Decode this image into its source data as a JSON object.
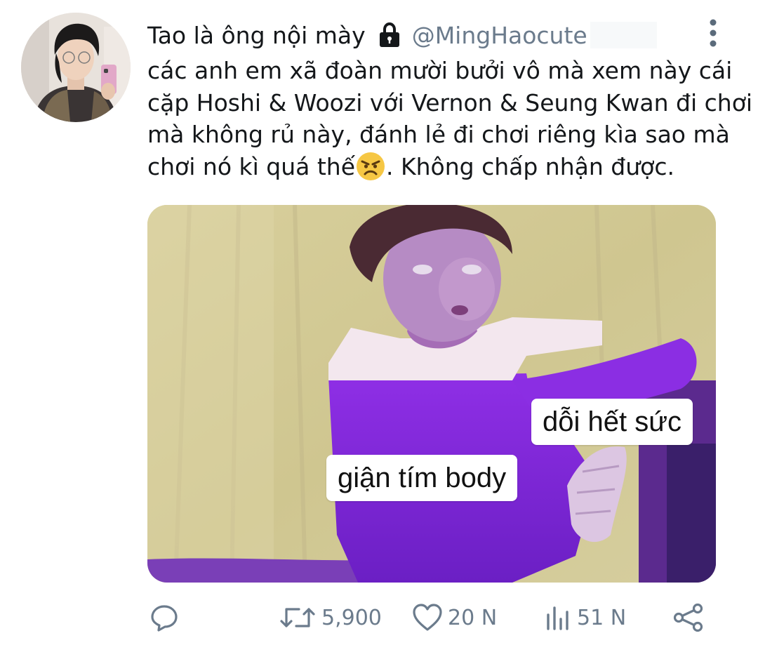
{
  "tweet": {
    "display_name": "Tao là ông nội mày",
    "handle": "@MingHaocute",
    "text_lines": [
      "các anh em xã đoàn mười bưởi vô mà xem này cái",
      "cặp Hoshi & Woozi với Vernon & Seung Kwan đi chơi",
      "mà không rủ này, đánh lẻ đi chơi riêng kìa sao mà",
      "chơi nó kì quá thế",
      ". Không chấp nhận được."
    ],
    "icons": {
      "lock": "lock-icon",
      "more": "more-vertical-icon",
      "emoji": "angry-face-emoji"
    }
  },
  "media": {
    "captions": [
      "dỗi hết sức",
      "giận tím body"
    ],
    "accent_color": "#8a2be2"
  },
  "actions": {
    "reply": {
      "icon": "reply-icon",
      "count": ""
    },
    "retweet": {
      "icon": "retweet-icon",
      "count": "5,900"
    },
    "like": {
      "icon": "heart-icon",
      "count": "20 N"
    },
    "views": {
      "icon": "views-icon",
      "count": "51 N"
    },
    "share": {
      "icon": "share-icon",
      "count": ""
    }
  },
  "colors": {
    "text": "#14171a",
    "muted": "#6b7b8c",
    "background": "#ffffff"
  }
}
